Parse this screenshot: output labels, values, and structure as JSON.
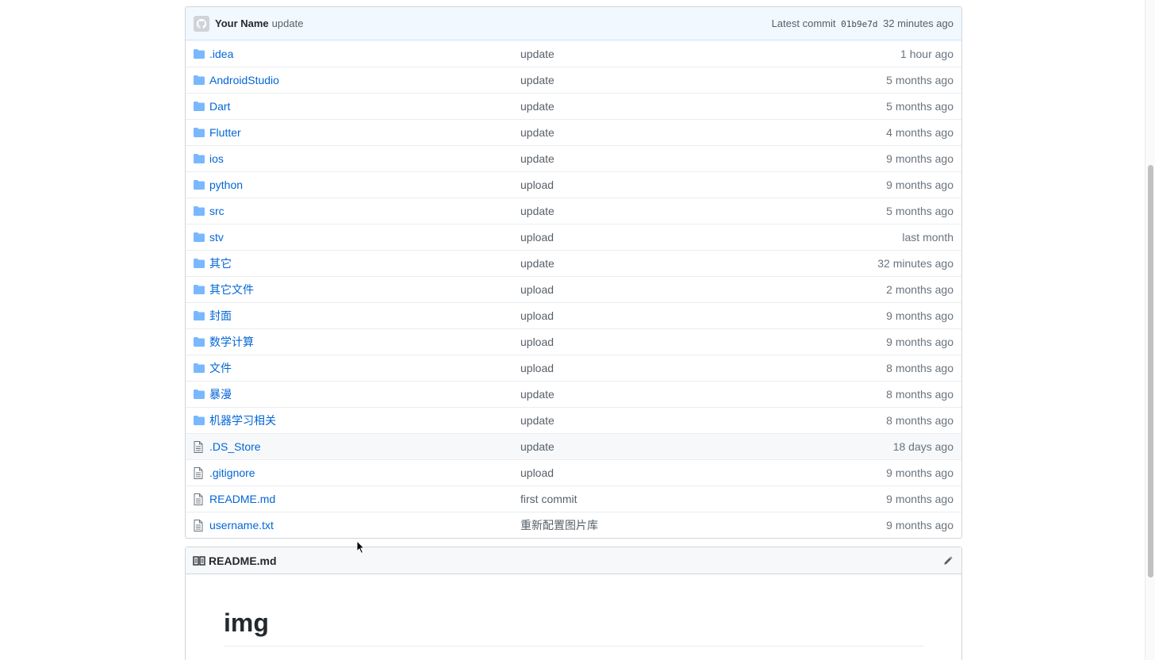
{
  "commit": {
    "author": "Your Name",
    "message": "update",
    "latest_label": "Latest commit",
    "sha": "01b9e7d",
    "age": "32 minutes ago"
  },
  "files": [
    {
      "type": "folder",
      "name": ".idea",
      "message": "update",
      "age": "1 hour ago"
    },
    {
      "type": "folder",
      "name": "AndroidStudio",
      "message": "update",
      "age": "5 months ago"
    },
    {
      "type": "folder",
      "name": "Dart",
      "message": "update",
      "age": "5 months ago"
    },
    {
      "type": "folder",
      "name": "Flutter",
      "message": "update",
      "age": "4 months ago"
    },
    {
      "type": "folder",
      "name": "ios",
      "message": "update",
      "age": "9 months ago"
    },
    {
      "type": "folder",
      "name": "python",
      "message": "upload",
      "age": "9 months ago"
    },
    {
      "type": "folder",
      "name": "src",
      "message": "update",
      "age": "5 months ago"
    },
    {
      "type": "folder",
      "name": "stv",
      "message": "upload",
      "age": "last month"
    },
    {
      "type": "folder",
      "name": "其它",
      "message": "update",
      "age": "32 minutes ago"
    },
    {
      "type": "folder",
      "name": "其它文件",
      "message": "upload",
      "age": "2 months ago"
    },
    {
      "type": "folder",
      "name": "封面",
      "message": "upload",
      "age": "9 months ago"
    },
    {
      "type": "folder",
      "name": "数学计算",
      "message": "upload",
      "age": "9 months ago"
    },
    {
      "type": "folder",
      "name": "文件",
      "message": "upload",
      "age": "8 months ago"
    },
    {
      "type": "folder",
      "name": "暴漫",
      "message": "update",
      "age": "8 months ago"
    },
    {
      "type": "folder",
      "name": "机器学习相关",
      "message": "update",
      "age": "8 months ago"
    },
    {
      "type": "file",
      "name": ".DS_Store",
      "message": "update",
      "age": "18 days ago"
    },
    {
      "type": "file",
      "name": ".gitignore",
      "message": "upload",
      "age": "9 months ago"
    },
    {
      "type": "file",
      "name": "README.md",
      "message": "first commit",
      "age": "9 months ago"
    },
    {
      "type": "file",
      "name": "username.txt",
      "message": "重新配置图片库",
      "age": "9 months ago"
    }
  ],
  "readme": {
    "filename": "README.md",
    "heading": "img"
  },
  "colors": {
    "link": "#0366d6",
    "folder_icon": "#79b8ff",
    "commit_bar_bg": "#f1f8ff"
  }
}
